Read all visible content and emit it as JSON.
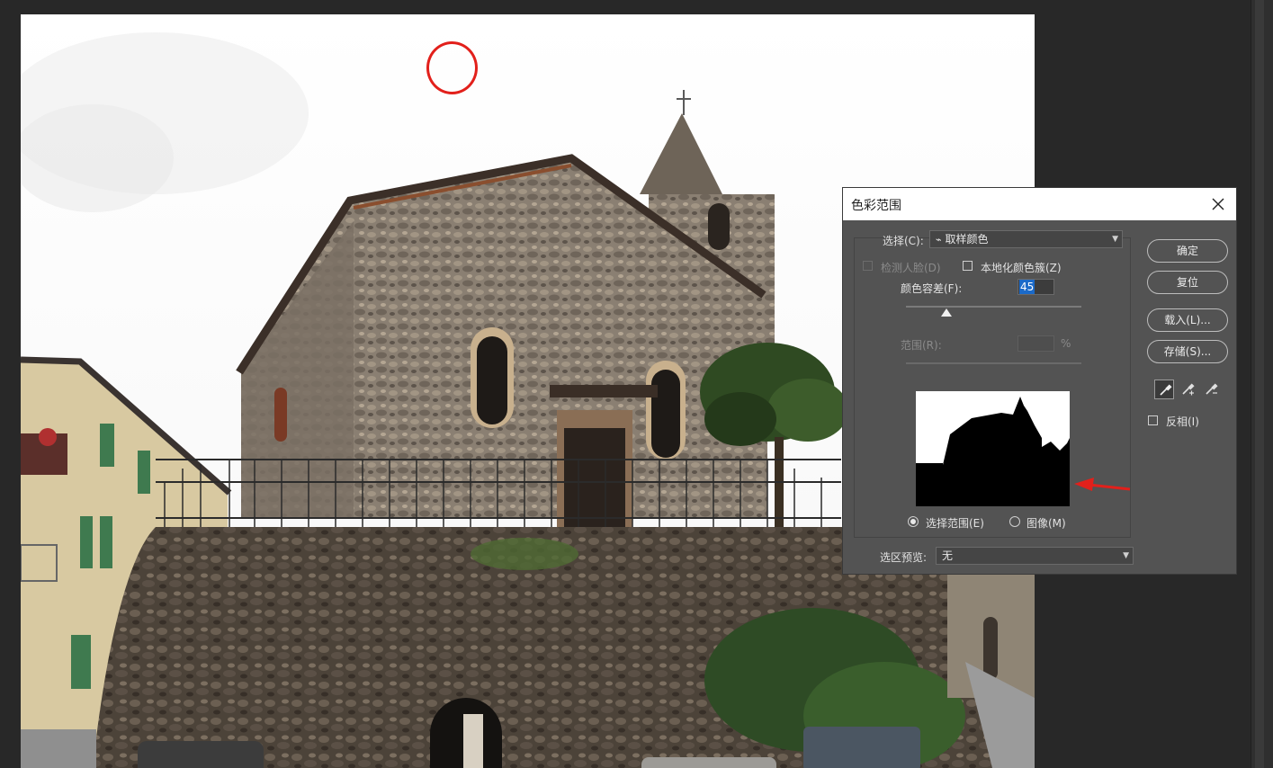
{
  "dialog": {
    "title": "色彩范围",
    "select_label": "选择(C):",
    "select_value": "取样颜色",
    "detect_faces_label": "检测人脸(D)",
    "localized_clusters_label": "本地化颜色簇(Z)",
    "fuzziness_label": "颜色容差(F):",
    "fuzziness_value": "45",
    "range_label": "范围(R):",
    "range_unit": "%",
    "radio_selection_label": "选择范围(E)",
    "radio_image_label": "图像(M)",
    "preview_label": "选区预览:",
    "preview_value": "无",
    "ok_button": "确定",
    "reset_button": "复位",
    "load_button": "载入(L)...",
    "save_button": "存储(S)...",
    "invert_label": "反相(I)"
  },
  "state": {
    "fuzziness_slider_fraction": 0.23,
    "selection_radio": "selection",
    "detect_faces_checked": false,
    "detect_faces_enabled": false,
    "localized_clusters_checked": false,
    "invert_checked": false,
    "active_eyedropper": "eyedropper"
  },
  "icons": [
    "close-icon",
    "eyedropper-icon",
    "eyedropper-plus-icon",
    "eyedropper-minus-icon"
  ],
  "colors": {
    "annotation_red": "#e2201b",
    "dialog_bg": "#535353",
    "workspace_bg": "#282828",
    "highlight_blue": "#1b6ac9"
  }
}
